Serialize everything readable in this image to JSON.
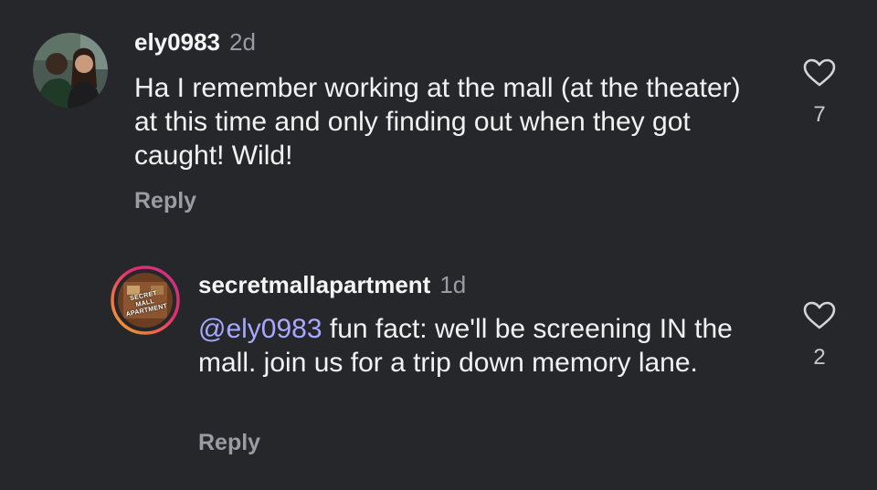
{
  "comments": [
    {
      "username": "ely0983",
      "time": "2d",
      "text": "Ha I remember working at the mall (at the theater) at this time and only finding out when they got caught! Wild!",
      "reply_label": "Reply",
      "like_count": "7",
      "avatar_icon": "profile-photo-couple",
      "like_icon": "heart-outline-icon"
    },
    {
      "username": "secretmallapartment",
      "time": "1d",
      "mention": "@ely0983",
      "text": " fun fact: we'll be screening IN the mall. join us for a trip down memory lane.",
      "reply_label": "Reply",
      "like_count": "2",
      "avatar_text": "SECRET MALL APARTMENT",
      "avatar_icon": "profile-logo-story-ring",
      "like_icon": "heart-outline-icon"
    }
  ],
  "colors": {
    "background": "#25272b",
    "mention": "#a7a8ff",
    "muted": "#9a9ca1",
    "story_ring_start": "#f9a826",
    "story_ring_end": "#d62976"
  }
}
